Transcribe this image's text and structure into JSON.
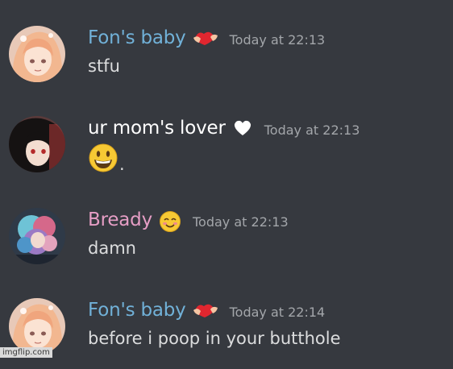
{
  "colors": {
    "background": "#36393f",
    "message_text": "#dcddde",
    "timestamp": "#a3a6aa",
    "name_fons_baby": "#71b1d8",
    "name_ur_moms_lover": "#ffffff",
    "name_bready": "#e69ec5"
  },
  "messages": [
    {
      "username": "Fon's baby",
      "badge_icon": "red-heart-hands-icon",
      "timestamp": "Today at 22:13",
      "content": "stfu",
      "avatar_icon": "anime-girl-avatar"
    },
    {
      "username": "ur mom's lover",
      "badge_icon": "white-heart-icon",
      "timestamp": "Today at 22:13",
      "content_emoji": "grinning-face-emoji",
      "content_suffix": ".",
      "avatar_icon": "dark-hair-anime-avatar"
    },
    {
      "username": "Bready",
      "badge_icon": "smiling-face-emoji",
      "timestamp": "Today at 22:13",
      "content": "damn",
      "avatar_icon": "colorful-hair-avatar"
    },
    {
      "username": "Fon's baby",
      "badge_icon": "red-heart-hands-icon",
      "timestamp": "Today at 22:14",
      "content": "before i poop in your butthole",
      "avatar_icon": "anime-girl-avatar"
    }
  ],
  "watermark": "imgflip.com"
}
